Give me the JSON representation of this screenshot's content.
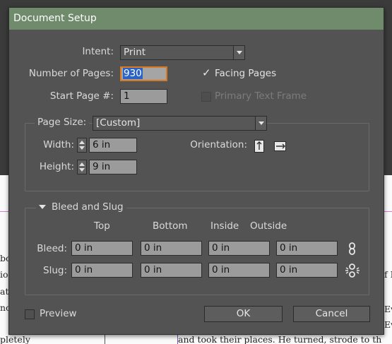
{
  "background_doc": {
    "left_lines": [
      "boo",
      "ion",
      "at",
      "no",
      "pletely"
    ],
    "right_lines": [
      "f I",
      "Ev",
      "Ev"
    ],
    "bottom_line": "and took their places. He turned, strode to th"
  },
  "dialog": {
    "title": "Document Setup",
    "intent": {
      "label": "Intent:",
      "value": "Print"
    },
    "pages": {
      "count_label": "Number of Pages:",
      "count_value": "930",
      "start_label": "Start Page #:",
      "start_value": "1",
      "facing_label": "Facing Pages",
      "facing_checked": true,
      "primary_label": "Primary Text Frame",
      "primary_checked": false
    },
    "page_size": {
      "label": "Page Size:",
      "value": "[Custom]",
      "width_label": "Width:",
      "width_value": "6 in",
      "height_label": "Height:",
      "height_value": "9 in",
      "orientation_label": "Orientation:",
      "orientation_icons": [
        "portrait-orientation-icon",
        "landscape-orientation-icon"
      ]
    },
    "bleed_slug": {
      "title": "Bleed and Slug",
      "columns": [
        "Top",
        "Bottom",
        "Inside",
        "Outside"
      ],
      "bleed_label": "Bleed:",
      "bleed_values": [
        "0 in",
        "0 in",
        "0 in",
        "0 in"
      ],
      "slug_label": "Slug:",
      "slug_values": [
        "0 in",
        "0 in",
        "0 in",
        "0 in"
      ],
      "link_icons": [
        "link-chain-icon",
        "broken-link-icon"
      ]
    },
    "preview_label": "Preview",
    "preview_checked": false,
    "ok_label": "OK",
    "cancel_label": "Cancel"
  },
  "colors": {
    "title_bar": "#6f8b6c",
    "panel": "#535353",
    "focus_border": "#d97a22",
    "selection": "#2a63c5"
  }
}
